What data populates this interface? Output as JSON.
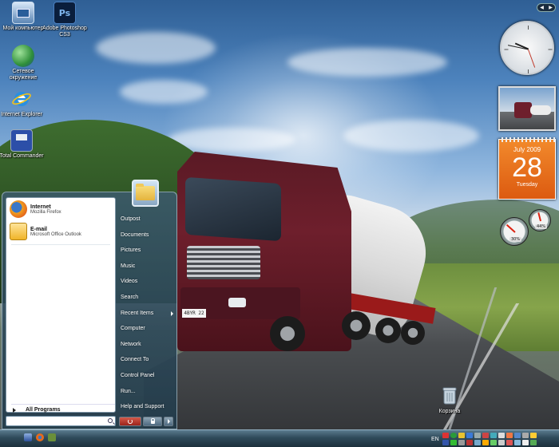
{
  "desktop": {
    "icons": [
      {
        "label": "Мой компьютер",
        "name": "my-computer-icon"
      },
      {
        "label": "Adobe Photoshop CS3",
        "name": "photoshop-icon"
      },
      {
        "label": "Сетевое окружение",
        "name": "network-places-icon"
      },
      {
        "label": "Internet Explorer",
        "name": "internet-explorer-icon"
      },
      {
        "label": "Total Commander",
        "name": "total-commander-icon"
      },
      {
        "label": "Корзина",
        "name": "recycle-bin-icon"
      }
    ],
    "photoshop_glyph": "Ps",
    "truck_plate": "4BYR 22"
  },
  "gadgets": {
    "calendar": {
      "month_year": "July 2009",
      "day": "28",
      "weekday": "Tuesday"
    },
    "clock": {
      "hour": 9,
      "minute": 47
    },
    "meter": {
      "cpu_percent": 30,
      "memory_percent": 44,
      "cpu_readout": "30%",
      "memory_readout": "44%"
    }
  },
  "start_menu": {
    "pinned": [
      {
        "title": "Internet",
        "subtitle": "Mozilla Firefox"
      },
      {
        "title": "E-mail",
        "subtitle": "Microsoft Office Outlook"
      }
    ],
    "all_programs": "All Programs",
    "search_placeholder": "",
    "right_items": [
      {
        "label": "Outpost",
        "submenu": false
      },
      {
        "label": "Documents",
        "submenu": false
      },
      {
        "label": "Pictures",
        "submenu": false
      },
      {
        "label": "Music",
        "submenu": false
      },
      {
        "label": "Videos",
        "submenu": false
      },
      {
        "label": "Search",
        "submenu": false
      },
      {
        "label": "Recent Items",
        "submenu": true
      },
      {
        "label": "Computer",
        "submenu": false
      },
      {
        "label": "Network",
        "submenu": false
      },
      {
        "label": "Connect To",
        "submenu": false
      },
      {
        "label": "Control Panel",
        "submenu": false
      },
      {
        "label": "Run...",
        "submenu": false
      },
      {
        "label": "Help and Support",
        "submenu": false
      }
    ]
  },
  "taskbar": {
    "language": "EN"
  },
  "colors": {
    "calendar_orange": "#e8721e",
    "firefox_orange": "#e66a1b",
    "outlook_yellow": "#f0b429",
    "power_red": "#c0392b"
  }
}
